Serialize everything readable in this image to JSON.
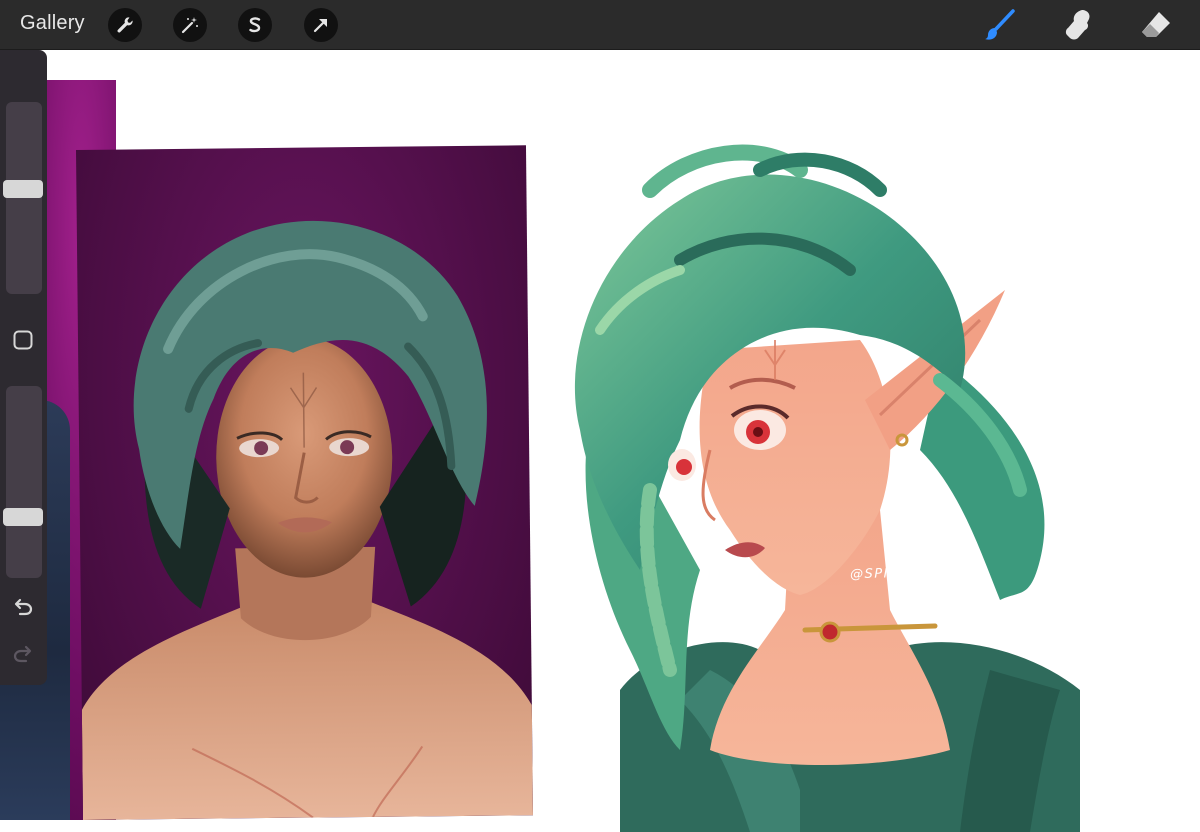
{
  "toolbar": {
    "gallery_label": "Gallery",
    "left_tools": [
      {
        "icon": "wrench-icon"
      },
      {
        "icon": "magic-wand-icon"
      },
      {
        "icon": "selection-s-icon"
      },
      {
        "icon": "arrow-transform-icon"
      }
    ],
    "right_tools": [
      {
        "icon": "brush-icon",
        "color": "#2f8cff"
      },
      {
        "icon": "smudge-icon",
        "color": "#e6e6e6"
      },
      {
        "icon": "eraser-icon",
        "color": "#e6e6e6"
      }
    ]
  },
  "sidebar": {
    "brush_size_level": 0.55,
    "opacity_level": 0.3
  },
  "artwork": {
    "watermark": "@SPIRALVISUAL"
  },
  "colors": {
    "toolbar_bg": "#2b2b2b",
    "accent": "#2f8cff",
    "hair_green": "#3f9a80",
    "skin": "#f2a489"
  }
}
